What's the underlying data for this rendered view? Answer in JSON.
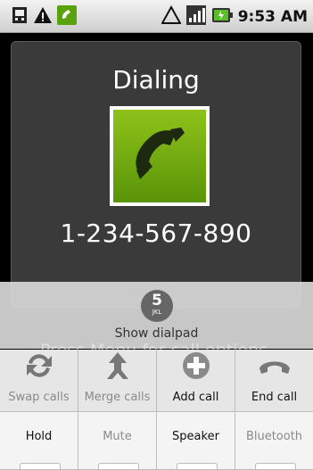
{
  "status_bar": {
    "time": "9:53 AM",
    "left_icons": [
      "sim-icon",
      "warning-icon",
      "call-active-icon"
    ],
    "right_icons": [
      "warning-icon",
      "signal-icon",
      "battery-icon"
    ]
  },
  "call": {
    "state": "Dialing",
    "number": "1-234-567-890",
    "photo_icon": "phone-handset-icon"
  },
  "dialpad": {
    "key_number": "5",
    "key_letters": "JKL",
    "label": "Show dialpad"
  },
  "menu_hint": "Press Menu for call options.",
  "buttons_row1": [
    {
      "label": "Swap calls",
      "icon": "swap-icon",
      "enabled": false
    },
    {
      "label": "Merge calls",
      "icon": "merge-icon",
      "enabled": false
    },
    {
      "label": "Add call",
      "icon": "add-call-icon",
      "enabled": true
    },
    {
      "label": "End call",
      "icon": "end-call-icon",
      "enabled": true
    }
  ],
  "buttons_row2": [
    {
      "label": "Hold",
      "enabled": true
    },
    {
      "label": "Mute",
      "enabled": false
    },
    {
      "label": "Speaker",
      "enabled": true
    },
    {
      "label": "Bluetooth",
      "enabled": false
    }
  ],
  "colors": {
    "photo_green": "#7ab712",
    "card_bg": "#3a3a3a"
  }
}
